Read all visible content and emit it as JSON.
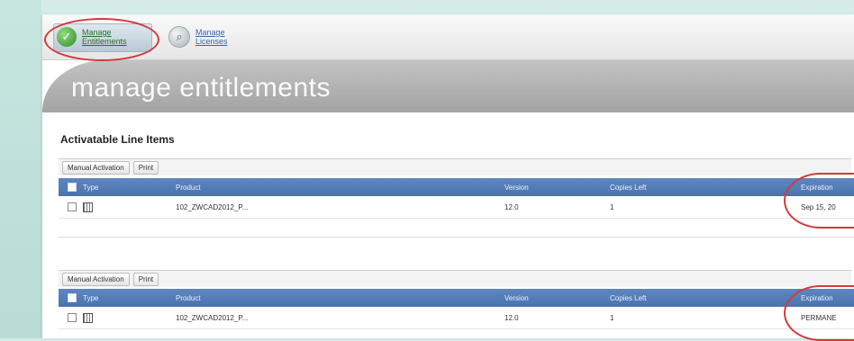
{
  "tabs": [
    {
      "label": "Manage Entitlements",
      "icon": "entitlements-icon",
      "active": true
    },
    {
      "label": "Manage Licenses",
      "icon": "licenses-icon",
      "active": false
    }
  ],
  "banner": {
    "title": "manage entitlements"
  },
  "section": {
    "title": "Activatable Line Items"
  },
  "toolbar": {
    "manual_activation": "Manual Activation",
    "print": "Print"
  },
  "table": {
    "columns": [
      "Type",
      "Product",
      "Version",
      "Copies Left",
      "Expiration"
    ]
  },
  "table1_row": {
    "product": "102_ZWCAD2012_P...",
    "version": "12.0",
    "copies_left": "1",
    "expiration": "Sep 15, 20"
  },
  "table2_row": {
    "product": "102_ZWCAD2012_P...",
    "version": "12.0",
    "copies_left": "1",
    "expiration": "PERMANE"
  },
  "colors": {
    "header": "#4a73ae",
    "annotation": "#d23a3a",
    "banner": "#a9a9a9"
  }
}
